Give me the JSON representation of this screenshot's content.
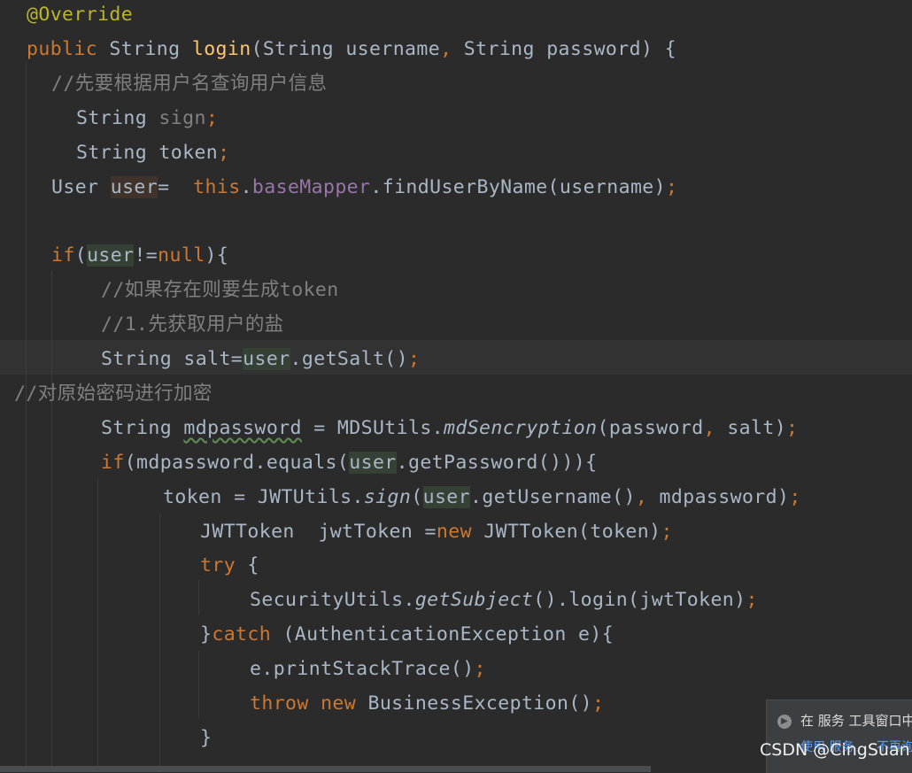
{
  "editor": {
    "lines": [
      [
        {
          "t": "@Override",
          "c": "ann"
        }
      ],
      [
        {
          "t": "public ",
          "c": "kw"
        },
        {
          "t": "String "
        },
        {
          "t": "login",
          "c": "fn"
        },
        {
          "t": "(String username"
        },
        {
          "t": ", ",
          "c": "kw"
        },
        {
          "t": "String password) {"
        }
      ],
      [
        {
          "t": "//先要根据用户名查询用户信息",
          "c": "cmt"
        }
      ],
      [
        {
          "t": "String "
        },
        {
          "t": "sign",
          "c": "cmt"
        },
        {
          "t": ";",
          "c": "kw"
        }
      ],
      [
        {
          "t": "String token"
        },
        {
          "t": ";",
          "c": "kw"
        }
      ],
      [
        {
          "t": "User "
        },
        {
          "t": "user",
          "c": "hl-write"
        },
        {
          "t": "=  "
        },
        {
          "t": "this",
          "c": "kw"
        },
        {
          "t": "."
        },
        {
          "t": "baseMapper",
          "c": "field"
        },
        {
          "t": ".findUserByName(username)"
        },
        {
          "t": ";",
          "c": "kw"
        }
      ],
      [],
      [
        {
          "t": "if",
          "c": "kw"
        },
        {
          "t": "("
        },
        {
          "t": "user",
          "c": "hl-read"
        },
        {
          "t": "!="
        },
        {
          "t": "null",
          "c": "kw"
        },
        {
          "t": "){"
        }
      ],
      [
        {
          "t": "//如果存在则要生成token",
          "c": "cmt"
        }
      ],
      [
        {
          "t": "//1.先获取用户的盐",
          "c": "cmt"
        }
      ],
      [
        {
          "t": "String salt="
        },
        {
          "t": "user",
          "c": "hl-read"
        },
        {
          "t": ".getSalt()"
        },
        {
          "t": ";",
          "c": "kw"
        }
      ],
      [
        {
          "t": "//对原始密码进行加密",
          "c": "cmt"
        }
      ],
      [
        {
          "t": "String "
        },
        {
          "t": "mdpassword",
          "c": "wavy"
        },
        {
          "t": " = MDSUtils."
        },
        {
          "t": "mdSencryption",
          "c": "it"
        },
        {
          "t": "(password"
        },
        {
          "t": ", ",
          "c": "kw"
        },
        {
          "t": "salt)"
        },
        {
          "t": ";",
          "c": "kw"
        }
      ],
      [
        {
          "t": "if",
          "c": "kw"
        },
        {
          "t": "(mdpassword.equals("
        },
        {
          "t": "user",
          "c": "hl-read"
        },
        {
          "t": ".getPassword())){"
        }
      ],
      [
        {
          "t": "token = JWTUtils."
        },
        {
          "t": "sign",
          "c": "it"
        },
        {
          "t": "("
        },
        {
          "t": "user",
          "c": "hl-read"
        },
        {
          "t": ".getUsername()"
        },
        {
          "t": ", ",
          "c": "kw"
        },
        {
          "t": "mdpassword)"
        },
        {
          "t": ";",
          "c": "kw"
        }
      ],
      [
        {
          "t": "JWTToken  jwtToken ="
        },
        {
          "t": "new ",
          "c": "kw"
        },
        {
          "t": "JWTToken(token)"
        },
        {
          "t": ";",
          "c": "kw"
        }
      ],
      [
        {
          "t": "try ",
          "c": "kw"
        },
        {
          "t": "{"
        }
      ],
      [
        {
          "t": "SecurityUtils."
        },
        {
          "t": "getSubject",
          "c": "it"
        },
        {
          "t": "().login(jwtToken)"
        },
        {
          "t": ";",
          "c": "kw"
        }
      ],
      [
        {
          "t": "}"
        },
        {
          "t": "catch ",
          "c": "kw"
        },
        {
          "t": "(AuthenticationException e){"
        }
      ],
      [
        {
          "t": "e.printStackTrace()"
        },
        {
          "t": ";",
          "c": "kw"
        }
      ],
      [
        {
          "t": "throw ",
          "c": "kw"
        },
        {
          "t": "new ",
          "c": "kw"
        },
        {
          "t": "BusinessException()"
        },
        {
          "t": ";",
          "c": "kw"
        }
      ],
      [
        {
          "t": "}"
        }
      ]
    ]
  },
  "notification": {
    "text": "在 服务 工具窗口中",
    "link1": "使用 服务",
    "link2": "不再询问"
  },
  "watermark": "CSDN @CingSuan",
  "colors": {
    "background": "#2b2b2b",
    "keyword": "#cc7832",
    "annotation": "#bbb529",
    "comment": "#808080",
    "method": "#ffc66d",
    "field": "#9876aa",
    "text": "#a9b7c6"
  }
}
